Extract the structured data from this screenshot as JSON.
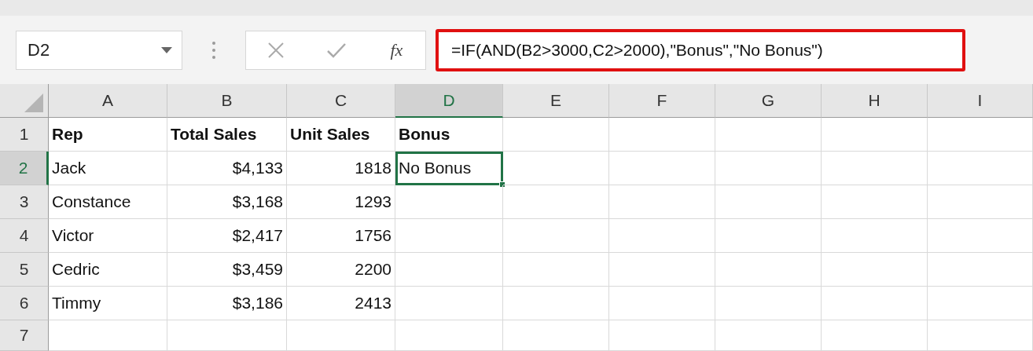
{
  "name_box": {
    "value": "D2"
  },
  "formula_bar": {
    "fx_label": "fx",
    "formula": "=IF(AND(B2>3000,C2>2000),\"Bonus\",\"No Bonus\")",
    "highlighted": true
  },
  "columns": [
    {
      "label": "A",
      "selected": false
    },
    {
      "label": "B",
      "selected": false
    },
    {
      "label": "C",
      "selected": false
    },
    {
      "label": "D",
      "selected": true
    },
    {
      "label": "E",
      "selected": false
    },
    {
      "label": "F",
      "selected": false
    },
    {
      "label": "G",
      "selected": false
    },
    {
      "label": "H",
      "selected": false
    },
    {
      "label": "I",
      "selected": false
    }
  ],
  "rows": [
    {
      "label": "1",
      "selected": false,
      "kind": "header",
      "cells": [
        {
          "text": "Rep",
          "kind": "text",
          "selected": false
        },
        {
          "text": "Total Sales",
          "kind": "text",
          "selected": false
        },
        {
          "text": "Unit Sales",
          "kind": "text",
          "selected": false
        },
        {
          "text": "Bonus",
          "kind": "text",
          "selected": false
        }
      ]
    },
    {
      "label": "2",
      "selected": true,
      "kind": "data",
      "cells": [
        {
          "text": "Jack",
          "kind": "text",
          "selected": false
        },
        {
          "text": "$4,133",
          "kind": "number",
          "selected": false
        },
        {
          "text": "1818",
          "kind": "number",
          "selected": false
        },
        {
          "text": "No Bonus",
          "kind": "text",
          "selected": true
        }
      ]
    },
    {
      "label": "3",
      "selected": false,
      "kind": "data",
      "cells": [
        {
          "text": "Constance",
          "kind": "text",
          "selected": false
        },
        {
          "text": "$3,168",
          "kind": "number",
          "selected": false
        },
        {
          "text": "1293",
          "kind": "number",
          "selected": false
        }
      ]
    },
    {
      "label": "4",
      "selected": false,
      "kind": "data",
      "cells": [
        {
          "text": "Victor",
          "kind": "text",
          "selected": false
        },
        {
          "text": "$2,417",
          "kind": "number",
          "selected": false
        },
        {
          "text": "1756",
          "kind": "number",
          "selected": false
        }
      ]
    },
    {
      "label": "5",
      "selected": false,
      "kind": "data",
      "cells": [
        {
          "text": "Cedric",
          "kind": "text",
          "selected": false
        },
        {
          "text": "$3,459",
          "kind": "number",
          "selected": false
        },
        {
          "text": "2200",
          "kind": "number",
          "selected": false
        }
      ]
    },
    {
      "label": "6",
      "selected": false,
      "kind": "data",
      "cells": [
        {
          "text": "Timmy",
          "kind": "text",
          "selected": false
        },
        {
          "text": "$3,186",
          "kind": "number",
          "selected": false
        },
        {
          "text": "2413",
          "kind": "number",
          "selected": false
        }
      ]
    },
    {
      "label": "7",
      "selected": false,
      "kind": "data",
      "cells": []
    }
  ]
}
